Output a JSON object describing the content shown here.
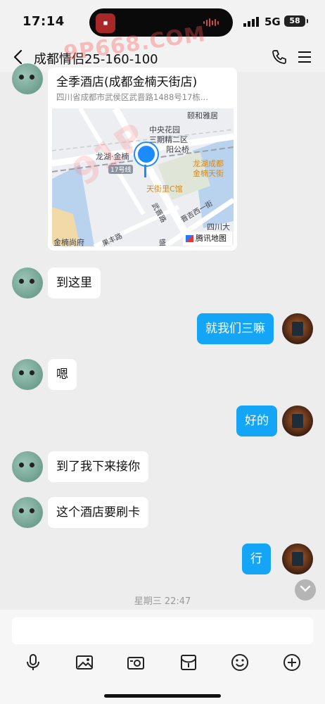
{
  "status_bar": {
    "time": "17:14",
    "network": "5G",
    "battery": "58"
  },
  "header": {
    "title": "成都情侣25-160-100"
  },
  "watermarks": {
    "top": "9P668.COM",
    "diagonal": "91P"
  },
  "location_card": {
    "name": "全季酒店(成都金楠天街店)",
    "address": "四川省成都市武侯区武晋路1488号17栋...",
    "map_labels": {
      "a": "中央花园",
      "b": "三期精二区",
      "c": "颐和雅居",
      "d": "龙湖·金楠",
      "e": "阳公桥",
      "f": "龙湖成都",
      "g": "金楠天街",
      "h": "17号线",
      "i": "天街里C馆",
      "j": "武晋路",
      "k": "晋吉西一街",
      "l": "四川大",
      "m": "金楠尚府",
      "n": "果丰路",
      "o": "盛"
    },
    "map_brand": "腾讯地图"
  },
  "messages": [
    {
      "side": "left",
      "text": "到这里"
    },
    {
      "side": "right",
      "text": "就我们三嘛"
    },
    {
      "side": "left",
      "text": "嗯"
    },
    {
      "side": "right",
      "text": "好的"
    },
    {
      "side": "left",
      "text": "到了我下来接你"
    },
    {
      "side": "left",
      "text": "这个酒店要刷卡"
    },
    {
      "side": "right",
      "text": "行"
    }
  ],
  "timestamp": "星期三 22:47",
  "toolbar": [
    "voice-icon",
    "image-icon",
    "camera-icon",
    "red-packet-icon",
    "emoji-icon",
    "plus-icon"
  ],
  "colors": {
    "bubble_self": "#15a5f7",
    "background": "#ededed",
    "pin": "#1a8cff"
  }
}
